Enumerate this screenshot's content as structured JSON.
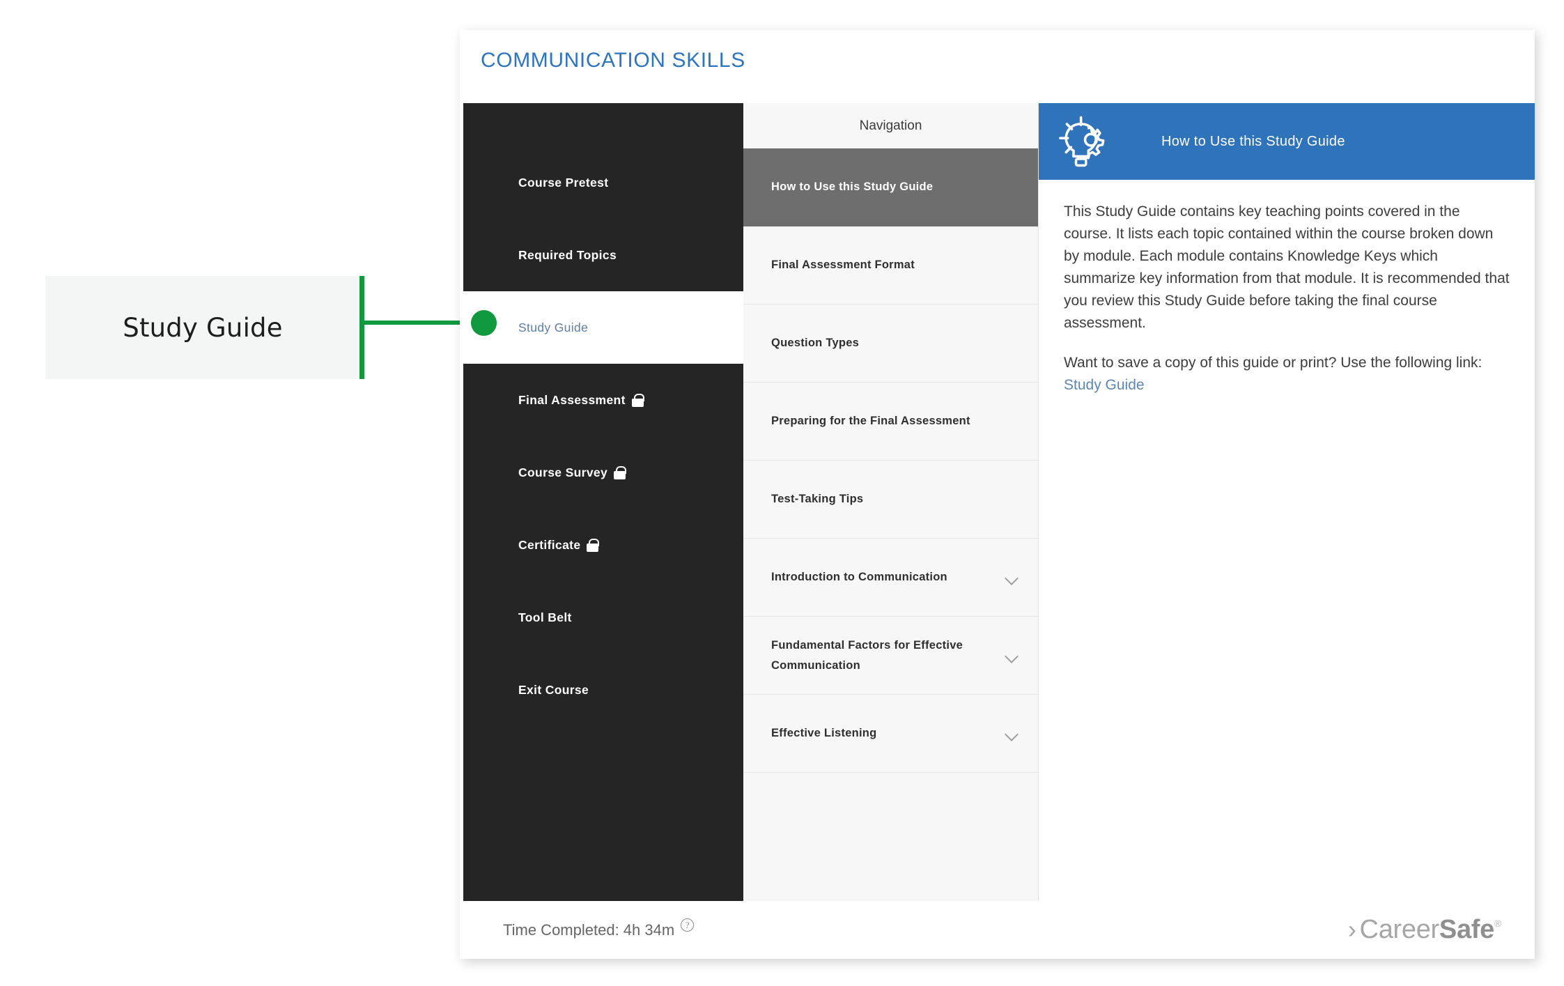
{
  "annotation": {
    "label": "Study Guide",
    "accent_color": "#10993f"
  },
  "course": {
    "title": "COMMUNICATION SKILLS",
    "title_color": "#2e75c0"
  },
  "sidebar": {
    "items": [
      {
        "label": "Course Pretest",
        "locked": false,
        "active": false
      },
      {
        "label": "Required Topics",
        "locked": false,
        "active": false
      },
      {
        "label": "Study Guide",
        "locked": false,
        "active": true
      },
      {
        "label": "Final Assessment",
        "locked": true,
        "active": false
      },
      {
        "label": "Course Survey",
        "locked": true,
        "active": false
      },
      {
        "label": "Certificate",
        "locked": true,
        "active": false
      },
      {
        "label": "Tool Belt",
        "locked": false,
        "active": false
      },
      {
        "label": "Exit Course",
        "locked": false,
        "active": false
      }
    ],
    "background_color": "#252525",
    "active_text_color": "#5b7fa6"
  },
  "navigation": {
    "header": "Navigation",
    "selected_color": "#6e6e6e",
    "items": [
      {
        "label": "How to Use this Study Guide",
        "expandable": false,
        "selected": true
      },
      {
        "label": "Final Assessment Format",
        "expandable": false,
        "selected": false
      },
      {
        "label": "Question Types",
        "expandable": false,
        "selected": false
      },
      {
        "label": "Preparing for the Final Assessment",
        "expandable": false,
        "selected": false
      },
      {
        "label": "Test-Taking Tips",
        "expandable": false,
        "selected": false
      },
      {
        "label": "Introduction to Communication",
        "expandable": true,
        "selected": false
      },
      {
        "label": "Fundamental Factors for Effective Communication",
        "expandable": true,
        "selected": false
      },
      {
        "label": "Effective Listening",
        "expandable": true,
        "selected": false
      }
    ]
  },
  "content": {
    "header_title": "How to Use this Study Guide",
    "header_color": "#2f73bb",
    "icon": "lightbulb-gear-icon",
    "paragraph_1": "This Study Guide contains key teaching points covered in the course. It lists each topic contained within the course broken down by module. Each module contains Knowledge Keys which summarize key information from that module. It is recommended that you review this Study Guide before taking the final course assessment.",
    "paragraph_2": "Want to save a copy of this guide or print? Use the following link:",
    "link_label": "Study Guide",
    "link_color": "#5d86b5"
  },
  "footer": {
    "time_completed": "Time Completed: 4h 34m",
    "help_icon": "?",
    "logo_chevron": "›",
    "logo_career": "Career",
    "logo_safe": "Safe",
    "logo_registered": "®"
  }
}
